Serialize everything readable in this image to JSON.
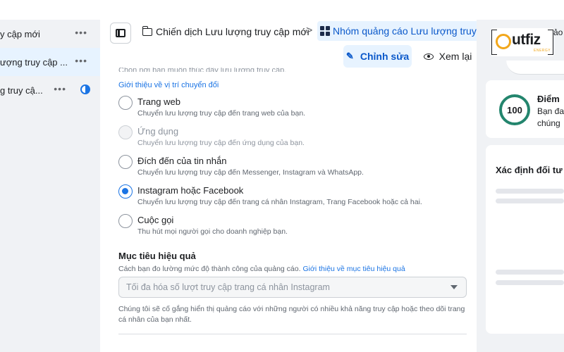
{
  "sidebar": {
    "items": [
      {
        "label": "y cập mới",
        "more": "•••"
      },
      {
        "label": "ượng truy cập ...",
        "more": "•••"
      },
      {
        "label": "g truy cậ...",
        "more": "•••"
      }
    ]
  },
  "breadcrumb": {
    "campaign": "Chiến dịch Lưu lượng truy cập mới",
    "separator": ">",
    "adset": "Nhóm quảng cáo Lưu lượng truy cập",
    "separator2": ">"
  },
  "actions": {
    "edit_label": "Chỉnh sửa",
    "review_label": "Xem lại"
  },
  "form": {
    "faded_text": "Chọn nơi bạn muốn thúc đẩy lưu lượng truy cập.",
    "learn_conversion": "Giới thiệu về vị trí chuyển đổi",
    "options": [
      {
        "title": "Trang web",
        "desc": "Chuyển lưu lượng truy cập đến trang web của bạn.",
        "state": "unselected"
      },
      {
        "title": "Ứng dụng",
        "desc": "Chuyển lưu lượng truy cập đến ứng dụng của bạn.",
        "state": "disabled"
      },
      {
        "title": "Đích đến của tin nhắn",
        "desc": "Chuyển lưu lượng truy cập đến Messenger, Instagram và WhatsApp.",
        "state": "unselected"
      },
      {
        "title": "Instagram hoặc Facebook",
        "desc": "Chuyển lưu lượng truy cập đến trang cá nhân Instagram, Trang Facebook hoặc cả hai.",
        "state": "selected"
      },
      {
        "title": "Cuộc gọi",
        "desc": "Thu hút mọi người gọi cho doanh nghiệp bạn.",
        "state": "unselected"
      }
    ],
    "goal_title": "Mục tiêu hiệu quả",
    "goal_sub": "Cách bạn đo lường mức độ thành công của quảng cáo.",
    "goal_link": "Giới thiệu về mục tiêu hiệu quả",
    "goal_select": "Tối đa hóa số lượt truy cập trang cá nhân Instagram",
    "goal_note": "Chúng tôi sẽ cố gắng hiển thị quảng cáo với những người có nhiều khả năng truy cập hoặc theo dõi trang cá nhân của bạn nhất."
  },
  "right_panel": {
    "score_value": "100",
    "score_title": "Điểm",
    "score_line1": "Bạn đa",
    "score_line2": "chúng",
    "audience_title": "Xác định đối tư"
  },
  "logo": {
    "word": "utfiz",
    "tag": "ENERGY"
  },
  "top_right_text": "ảo",
  "colors": {
    "accent": "#1b74e4",
    "selected_bg": "#e7f3ff",
    "score_ring": "#23856d",
    "logo_orange": "#f2a71b"
  }
}
